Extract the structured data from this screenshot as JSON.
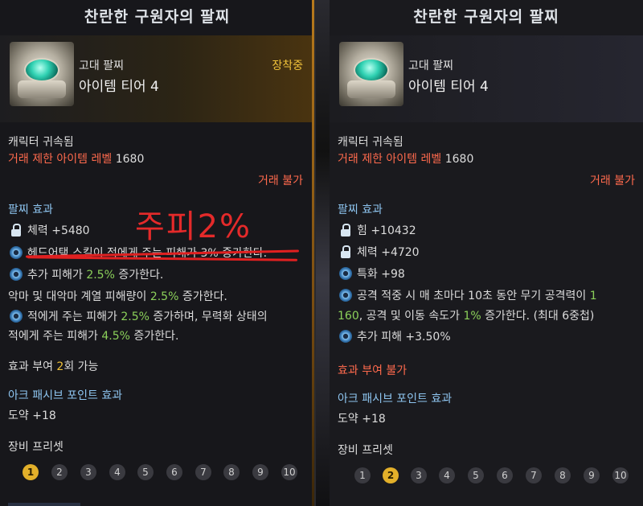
{
  "left": {
    "title": "찬란한 구원자의 팔찌",
    "item_type": "고대 팔찌",
    "item_tier": "아이템 티어 4",
    "equipped": "장착중",
    "bound": "캐릭터 귀속됨",
    "trade_limit_label": "거래 제한 아이템 레벨",
    "trade_limit_value": "1680",
    "trade_status": "거래 불가",
    "effects_header": "팔찌 효과",
    "effects": [
      {
        "icon": "lock-icon",
        "text": "체력 +5480"
      },
      {
        "icon": "swirl-icon",
        "text": "헤드어택 스킬이 적에게 주는 피해가 3% 증가한다."
      },
      {
        "icon": "swirl-icon",
        "pre": "추가 피해가 ",
        "hl": "2.5%",
        "post": " 증가한다."
      },
      {
        "icon": "",
        "pre": "악마 및 대악마 계열 피해량이 ",
        "hl": "2.5%",
        "post": " 증가한다."
      },
      {
        "icon": "swirl-icon",
        "pre": "적에게 주는 피해가 ",
        "hl": "2.5%",
        "post": " 증가하며, 무력화 상태의"
      },
      {
        "icon": "",
        "pre": "적에게 주는 피해가 ",
        "hl": "4.5%",
        "post": " 증가한다."
      }
    ],
    "grant_pre": "효과 부여 ",
    "grant_count": "2",
    "grant_post": "회 가능",
    "ark_header": "아크 패시브 포인트 효과",
    "ark_value": "도약 +18",
    "preset_header": "장비 프리셋",
    "presets": [
      "1",
      "2",
      "3",
      "4",
      "5",
      "6",
      "7",
      "8",
      "9",
      "10"
    ],
    "active_preset": 1,
    "annotation": "주피2%"
  },
  "right": {
    "title": "찬란한 구원자의 팔찌",
    "item_type": "고대 팔찌",
    "item_tier": "아이템 티어 4",
    "bound": "캐릭터 귀속됨",
    "trade_limit_label": "거래 제한 아이템 레벨",
    "trade_limit_value": "1680",
    "trade_status": "거래 불가",
    "effects_header": "팔찌 효과",
    "effects": [
      {
        "icon": "lock-icon",
        "text": "힘 +10432"
      },
      {
        "icon": "lock-icon",
        "text": "체력 +4720"
      },
      {
        "icon": "swirl-icon",
        "text": "특화 +98"
      },
      {
        "icon": "swirl-icon",
        "pre": "공격 적중 시 매 초마다 10초 동안 무기 공격력이 ",
        "hl": "1",
        "post": ""
      },
      {
        "icon": "",
        "pre": "",
        "hl": "160",
        "post": ", 공격 및 이동 속도가 "
      },
      {
        "icon": "swirl-icon",
        "text": "추가 피해 +3.50%"
      }
    ],
    "effects_line5_hl2": "1%",
    "effects_line5_tail": " 증가한다. (최대 6중첩)",
    "grant": "효과 부여 불가",
    "ark_header": "아크 패시브 포인트 효과",
    "ark_value": "도약 +18",
    "preset_header": "장비 프리셋",
    "presets": [
      "1",
      "2",
      "3",
      "4",
      "5",
      "6",
      "7",
      "8",
      "9",
      "10"
    ],
    "active_preset": 2
  },
  "colors": {
    "accent_gold": "#f0c23a",
    "warning_red": "#ff6a4d",
    "label_blue": "#8ec5f0",
    "value_green": "#8bd05a",
    "annotation_red": "#e42a2a"
  }
}
